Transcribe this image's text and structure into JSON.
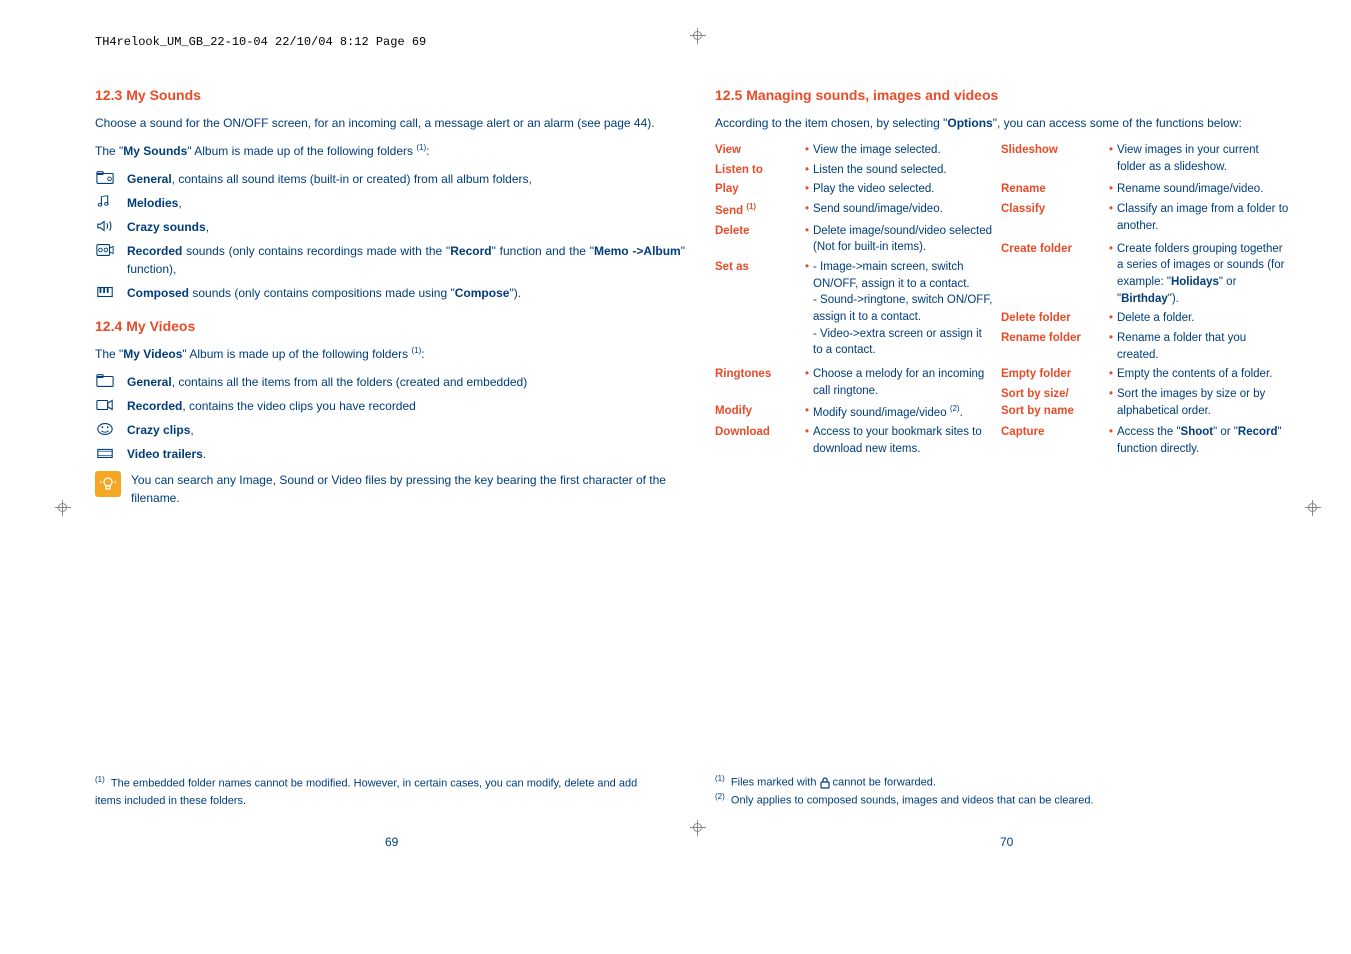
{
  "header_line": "TH4relook_UM_GB_22-10-04  22/10/04  8:12  Page 69",
  "left": {
    "s123": {
      "num": "12.3",
      "title": "My Sounds"
    },
    "intro123": "Choose a sound for the ON/OFF screen, for an incoming call, a message alert or an alarm (see page 44).",
    "sounds_intro_a": "The \"",
    "sounds_intro_b": "My Sounds",
    "sounds_intro_c": "\" Album is made up of the following folders ",
    "sounds_intro_d": ":",
    "sounds": {
      "general_b": "General",
      "general_t": ", contains all sound items (built-in or created) from all album folders,",
      "melodies_b": "Melodies",
      "melodies_t": ",",
      "crazy_b": "Crazy sounds",
      "crazy_t": ",",
      "recorded_b": "Recorded",
      "recorded_t1": " sounds (only contains recordings made with the \"",
      "recorded_b2": "Record",
      "recorded_t2": "\" function and the \"",
      "recorded_b3": "Memo ->Album",
      "recorded_t3": "\" function),",
      "composed_b": "Composed",
      "composed_t1": " sounds (only contains compositions made using \"",
      "composed_b2": "Compose",
      "composed_t2": "\")."
    },
    "s124": {
      "num": "12.4",
      "title": "My Videos"
    },
    "videos_intro_a": "The \"",
    "videos_intro_b": "My Videos",
    "videos_intro_c": "\" Album is made up of the following folders ",
    "videos_intro_d": ":",
    "videos": {
      "general_b": "General",
      "general_t": ", contains all the items from all the folders (created and embedded)",
      "recorded_b": "Recorded",
      "recorded_t": ", contains the video clips you have recorded",
      "crazy_b": "Crazy clips",
      "crazy_t": ",",
      "trailers_b": "Video trailers",
      "trailers_t": "."
    },
    "tip": "You can search any Image, Sound or Video files by pressing the key bearing the first character of the filename.",
    "footnote_sup": "(1)",
    "footnote": "The embedded folder names cannot be modified. However, in certain cases, you can modify, delete and add items included in these folders.",
    "page_num": "69"
  },
  "right": {
    "s125": {
      "num": "12.5",
      "title": "Managing sounds, images and videos"
    },
    "intro_a": "According to the item chosen, by selecting \"",
    "intro_b": "Options",
    "intro_c": "\", you can access some of the functions below:",
    "opts": {
      "view_l": "View",
      "view_d": "View the image selected.",
      "listen_l": "Listen to",
      "listen_d": "Listen the sound selected.",
      "play_l": "Play",
      "play_d": "Play the video selected.",
      "send_l": "Send ",
      "send_sup": "(1)",
      "send_d": "Send sound/image/video.",
      "delete_l": "Delete",
      "delete_d": "Delete image/sound/video selected (Not for built-in items).",
      "setas_l": "Set as",
      "setas_d1": "- Image->main screen, switch ON/OFF, assign it to a contact.",
      "setas_d2": "- Sound->ringtone, switch ON/OFF, assign it to a contact.",
      "setas_d3": "- Video->extra screen or assign it to a contact.",
      "ring_l": "Ringtones",
      "ring_d": "Choose a melody for an incoming call ringtone.",
      "modify_l": "Modify",
      "modify_d": "Modify sound/image/video ",
      "modify_sup": "(2)",
      "modify_dot": ".",
      "download_l": "Download",
      "download_d": "Access to your bookmark sites to download new items.",
      "slideshow_l": "Slideshow",
      "slideshow_d": "View images in your current folder as a slideshow.",
      "rename_l": "Rename",
      "rename_d": "Rename sound/image/video.",
      "classify_l": "Classify",
      "classify_d": "Classify an image from a folder to another.",
      "createf_l": "Create folder",
      "createf_d1": "Create folders grouping together a series of images or sounds (for example: \"",
      "createf_b1": "Holidays",
      "createf_d2": "\" or \"",
      "createf_b2": "Birthday",
      "createf_d3": "\").",
      "deletef_l": "Delete folder",
      "deletef_d": "Delete a folder.",
      "renamef_l": "Rename folder",
      "renamef_d": "Rename a folder that you created.",
      "emptyf_l": "Empty folder",
      "emptyf_d": "Empty the contents of a folder.",
      "sort_l1": "Sort by size/",
      "sort_l2": "Sort by name",
      "sort_d": "Sort the images by size or by alphabetical order.",
      "capture_l": "Capture",
      "capture_d1": "Access the \"",
      "capture_b1": "Shoot",
      "capture_d2": "\" or \"",
      "capture_b2": "Record",
      "capture_d3": "\" function directly."
    },
    "fn1_sup": "(1)",
    "fn1_a": "Files marked with ",
    "fn1_b": " cannot be forwarded.",
    "fn2_sup": "(2)",
    "fn2": "Only applies to composed sounds, images and videos that can be cleared.",
    "page_num": "70"
  }
}
